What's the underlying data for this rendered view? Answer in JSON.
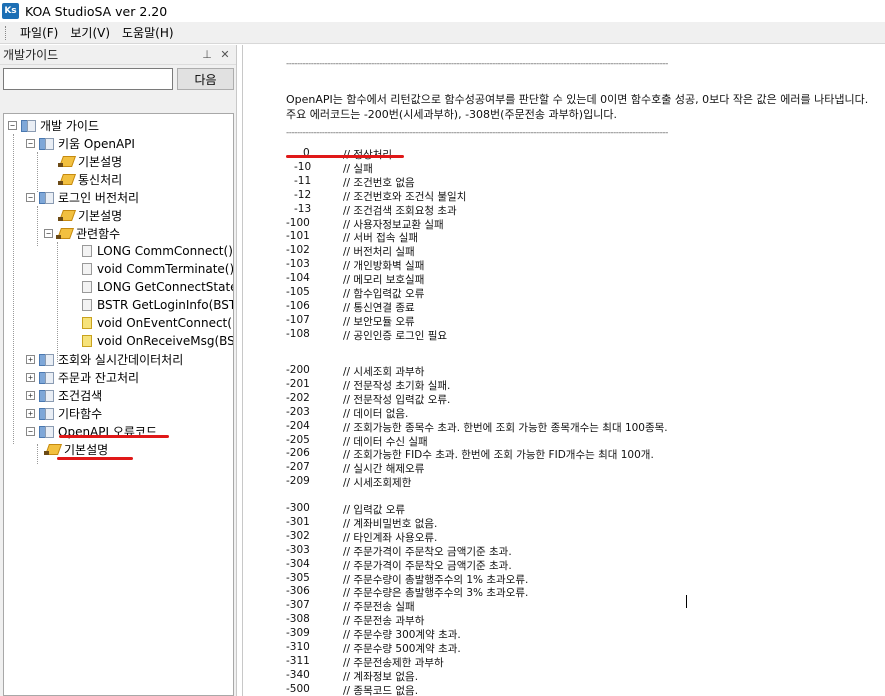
{
  "window": {
    "icon_text": "Ks",
    "title": "KOA StudioSA ver 2.20"
  },
  "menu": [
    "파일(F)",
    "보기(V)",
    "도움말(H)"
  ],
  "panel": {
    "title": "개발가이드",
    "pin_icon": "pin-icon",
    "close_icon": "close-icon",
    "search_value": "",
    "next_label": "다음"
  },
  "tree": [
    {
      "label": "개발 가이드"
    },
    {
      "label": "키움 OpenAPI"
    },
    {
      "label": "기본설명"
    },
    {
      "label": "통신처리"
    },
    {
      "label": "로그인 버전처리"
    },
    {
      "label": "기본설명"
    },
    {
      "label": "관련함수"
    },
    {
      "label": "LONG CommConnect()"
    },
    {
      "label": "void CommTerminate()"
    },
    {
      "label": "LONG GetConnectState()"
    },
    {
      "label": "BSTR GetLoginInfo(BSTR"
    },
    {
      "label": "void OnEventConnect(lo"
    },
    {
      "label": "void OnReceiveMsg(BSTI"
    },
    {
      "label": "조회와 실시간데이터처리"
    },
    {
      "label": "주문과 잔고처리"
    },
    {
      "label": "조건검색"
    },
    {
      "label": "기타함수"
    },
    {
      "label": "OpenAPI 오류코드"
    },
    {
      "label": "기본설명"
    }
  ],
  "content": {
    "divider": "-------------------------------------------------------------------------------------------------------------------------------------------",
    "description": [
      "OpenAPI는 함수에서 리턴값으로 함수성공여부를 판단할 수 있는데 0이면 함수호출 성공, 0보다 작은 값은 에러를 나타냅니다.",
      "주요 에러코드는 -200번(시세과부하), -308번(주문전송 과부하)입니다."
    ],
    "error_codes": [
      {
        "code": "0",
        "text": "// 정상처리"
      },
      {
        "code": "-10",
        "text": "// 실패"
      },
      {
        "code": "-11",
        "text": "// 조건번호 없음"
      },
      {
        "code": "-12",
        "text": "// 조건번호와 조건식 불일치"
      },
      {
        "code": "-13",
        "text": "// 조건검색 조회요청 초과"
      },
      {
        "code": "-100",
        "text": "// 사용자정보교환 실패"
      },
      {
        "code": "-101",
        "text": "// 서버 접속 실패"
      },
      {
        "code": "-102",
        "text": "// 버전처리 실패"
      },
      {
        "code": "-103",
        "text": "// 개인방화벽 실패"
      },
      {
        "code": "-104",
        "text": "// 메모리 보호실패"
      },
      {
        "code": "-105",
        "text": "// 함수입력값 오류"
      },
      {
        "code": "-106",
        "text": "// 통신연결 종료"
      },
      {
        "code": "-107",
        "text": "// 보안모듈 오류"
      },
      {
        "code": "-108",
        "text": "// 공인인증 로그인 필요"
      },
      {
        "code": "-200",
        "text": "// 시세조회 과부하"
      },
      {
        "code": "-201",
        "text": "// 전문작성 초기화 실패."
      },
      {
        "code": "-202",
        "text": "// 전문작성 입력값 오류."
      },
      {
        "code": "-203",
        "text": "// 데이터 없음."
      },
      {
        "code": "-204",
        "text": "// 조회가능한 종목수 초과. 한번에 조회 가능한 종목개수는 최대 100종목."
      },
      {
        "code": "-205",
        "text": "// 데이터 수신 실패"
      },
      {
        "code": "-206",
        "text": "// 조회가능한 FID수 초과. 한번에 조회 가능한 FID개수는 최대 100개."
      },
      {
        "code": "-207",
        "text": "// 실시간 해제오류"
      },
      {
        "code": "-209",
        "text": "// 시세조회제한"
      },
      {
        "code": "-300",
        "text": "// 입력값 오류"
      },
      {
        "code": "-301",
        "text": "// 계좌비밀번호 없음."
      },
      {
        "code": "-302",
        "text": "// 타인계좌 사용오류."
      },
      {
        "code": "-303",
        "text": "// 주문가격이 주문착오 금액기준 초과."
      },
      {
        "code": "-304",
        "text": "// 주문가격이 주문착오 금액기준 초과."
      },
      {
        "code": "-305",
        "text": "// 주문수량이 총발행주수의 1% 초과오류."
      },
      {
        "code": "-306",
        "text": "// 주문수량은 총발행주수의 3% 초과오류."
      },
      {
        "code": "-307",
        "text": "// 주문전송 실패"
      },
      {
        "code": "-308",
        "text": "// 주문전송 과부하"
      },
      {
        "code": "-309",
        "text": "// 주문수량 300계약 초과."
      },
      {
        "code": "-310",
        "text": "// 주문수량 500계약 초과."
      },
      {
        "code": "-311",
        "text": "// 주문전송제한 과부하"
      },
      {
        "code": "-340",
        "text": "// 계좌정보 없음."
      },
      {
        "code": "-500",
        "text": "// 종목코드 없음."
      }
    ]
  },
  "colors": {
    "annotation_red": "#e01818",
    "icon_blue": "#1c6fb5"
  }
}
